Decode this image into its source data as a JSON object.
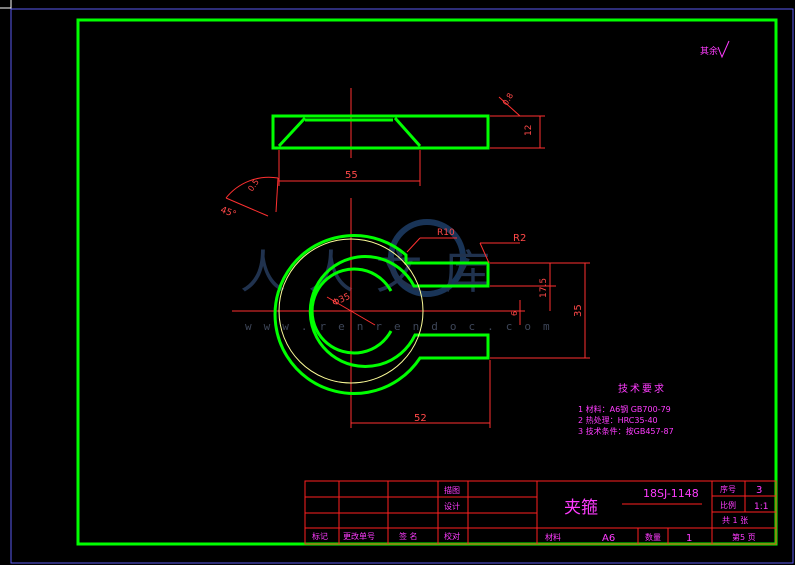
{
  "drawing": {
    "roughness": "其余",
    "tech_req": {
      "title": "技术要求",
      "items": [
        "1 材料：A6钢 GB700-79",
        "2 热处理：HRC35-40",
        "3 技术条件：按GB457-87"
      ]
    },
    "watermark": {
      "brand": "人人文库",
      "url": "www.renrendoc.com"
    },
    "dimensions": {
      "chamfer": "0.8",
      "height": "12",
      "width_top": "55",
      "angle_chamfer": "0.5",
      "angle": "45°",
      "r10": "R10",
      "r2": "R2",
      "dia": "Φ35",
      "d17_5": "17.5",
      "d6": "6",
      "d35": "35",
      "d52": "52"
    }
  },
  "title_block": {
    "part_name": "夹箍",
    "drawing_no": "18SJ-1148",
    "drawn_label": "描图",
    "design_label": "设计",
    "check_label": "校对",
    "mark_label": "标记",
    "change_doc_label": "更改单号",
    "sign_label": "签 名",
    "material_label": "材料",
    "material_value": "A6",
    "qty_label": "数量",
    "qty_value": "1",
    "seq_label": "序号",
    "seq_value": "3",
    "scale_label": "比例",
    "scale_value": "1:1",
    "sheet_text": "共 1 张",
    "page_text": "第5 页"
  }
}
